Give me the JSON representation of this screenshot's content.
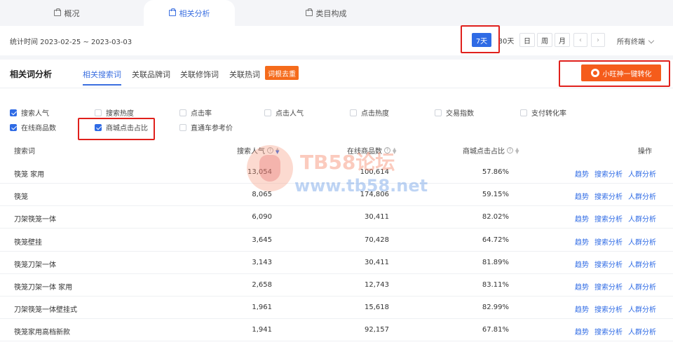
{
  "tabs": [
    {
      "label": "概况",
      "active": false
    },
    {
      "label": "相关分析",
      "active": true
    },
    {
      "label": "类目构成",
      "active": false
    }
  ],
  "stats": {
    "time_label": "统计时间 2023-02-25 ~ 2023-03-03",
    "periods": [
      "7天",
      "30天",
      "日",
      "周",
      "月"
    ],
    "active_period": "7天",
    "prev": "‹",
    "next": "›",
    "terminal": "所有终端"
  },
  "section": {
    "title": "相关词分析",
    "subtabs": [
      "相关搜索词",
      "关联品牌词",
      "关联修饰词",
      "关联热词"
    ],
    "active_subtab": "相关搜索词",
    "dedupe_label": "词根去重",
    "cta_label": "小旺神一键转化"
  },
  "metrics": [
    {
      "label": "搜索人气",
      "checked": true
    },
    {
      "label": "搜索热度",
      "checked": false
    },
    {
      "label": "点击率",
      "checked": false
    },
    {
      "label": "点击人气",
      "checked": false
    },
    {
      "label": "点击热度",
      "checked": false
    },
    {
      "label": "交易指数",
      "checked": false
    },
    {
      "label": "支付转化率",
      "checked": false
    },
    {
      "label": "在线商品数",
      "checked": true
    },
    {
      "label": "商城点击占比",
      "checked": true
    },
    {
      "label": "直通车参考价",
      "checked": false
    }
  ],
  "table": {
    "headers": {
      "keyword": "搜索词",
      "search_pop": "搜索人气",
      "online_items": "在线商品数",
      "mall_click": "商城点击占比",
      "ops": "操作"
    },
    "actions": [
      "趋势",
      "搜索分析",
      "人群分析"
    ],
    "rows": [
      {
        "keyword": "筷笼 家用",
        "search_pop": "13,054",
        "online_items": "100,614",
        "mall_click": "57.86%"
      },
      {
        "keyword": "筷笼",
        "search_pop": "8,065",
        "online_items": "174,806",
        "mall_click": "59.15%"
      },
      {
        "keyword": "刀架筷笼一体",
        "search_pop": "6,090",
        "online_items": "30,411",
        "mall_click": "82.02%"
      },
      {
        "keyword": "筷笼壁挂",
        "search_pop": "3,645",
        "online_items": "70,428",
        "mall_click": "64.72%"
      },
      {
        "keyword": "筷笼刀架一体",
        "search_pop": "3,143",
        "online_items": "30,411",
        "mall_click": "81.89%"
      },
      {
        "keyword": "筷笼刀架一体 家用",
        "search_pop": "2,658",
        "online_items": "12,743",
        "mall_click": "83.11%"
      },
      {
        "keyword": "刀架筷笼一体壁挂式",
        "search_pop": "1,961",
        "online_items": "15,618",
        "mall_click": "82.99%"
      },
      {
        "keyword": "筷笼家用高档新款",
        "search_pop": "1,941",
        "online_items": "92,157",
        "mall_click": "67.81%"
      }
    ]
  },
  "watermark": {
    "line1": "TB58论坛",
    "line2": "www.tb58.net"
  },
  "colors": {
    "accent": "#2f6be5",
    "orange": "#f55c1b",
    "highlight": "#e0201c"
  }
}
